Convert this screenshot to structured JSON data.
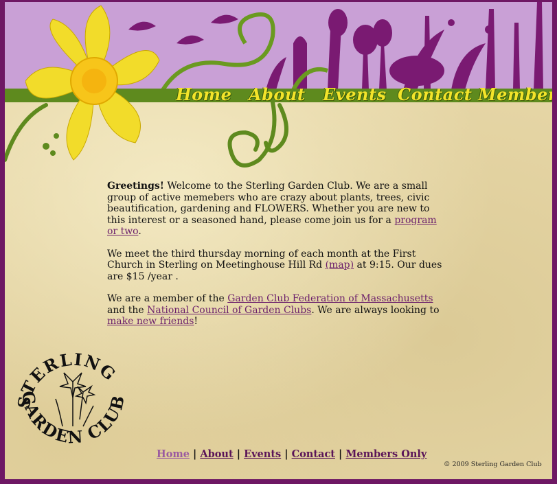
{
  "nav": {
    "items": [
      "Home",
      "About",
      "Events",
      "Contact",
      "Members"
    ]
  },
  "content": {
    "greeting_bold": "Greetings!",
    "p1_text": " Welcome to the Sterling Garden Club. We are a small group of active memebers who are crazy about plants, trees, civic beautification, gardening and FLOWERS.  Whether you are new to this interest or a seasoned hand, please come join us for a ",
    "p1_link": "program or two",
    "p1_end": ".",
    "p2_text": "We meet the third thursday morning of each month at the First Church in Sterling on Meetinghouse Hill Rd ",
    "p2_link": "(map)",
    "p2_end": " at 9:15.  Our dues are $15 /year .",
    "p3_text": "We are a member of the ",
    "p3_link1": "Garden Club Federation of Massachusetts",
    "p3_mid": " and the ",
    "p3_link2": "National Council of Garden Clubs",
    "p3_mid2": ".   We are always looking to ",
    "p3_link3": "make new friends",
    "p3_end": "!"
  },
  "footer": {
    "links": [
      "Home",
      "About",
      "Events",
      "Contact",
      "Members Only"
    ],
    "separator": "|",
    "copyright": "© 2009 Sterling Garden Club"
  },
  "logo": {
    "text_top": "STERLING",
    "text_bottom": "GARDEN CLUB"
  },
  "colors": {
    "frame": "#6e1864",
    "banner": "#c9a0d6",
    "vine": "#5e8a1e",
    "nav_text": "#f3e42a",
    "link": "#6b1f6b",
    "daffodil": "#f2dc2a"
  }
}
